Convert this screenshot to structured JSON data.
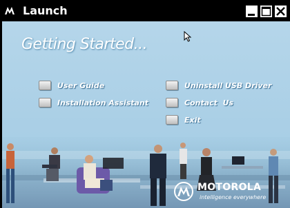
{
  "window": {
    "title": "Launch"
  },
  "heading": "Getting Started...",
  "menu": {
    "left": [
      {
        "label": "User Guide"
      },
      {
        "label": "Installation Assistant"
      }
    ],
    "right": [
      {
        "label": "Uninstall USB Driver"
      },
      {
        "label": "Contact  Us"
      },
      {
        "label": "Exit"
      }
    ]
  },
  "brand": {
    "name": "MOTOROLA",
    "tagline": "intelligence everywhere"
  },
  "icons": {
    "minimize": "minimize-icon",
    "maximize": "maximize-icon",
    "close": "close-icon",
    "logo": "motorola-logo-icon",
    "cursor": "mouse-pointer-icon"
  },
  "colors": {
    "titlebar": "#000000",
    "background": "#b5d6ea",
    "text": "#ffffff"
  }
}
